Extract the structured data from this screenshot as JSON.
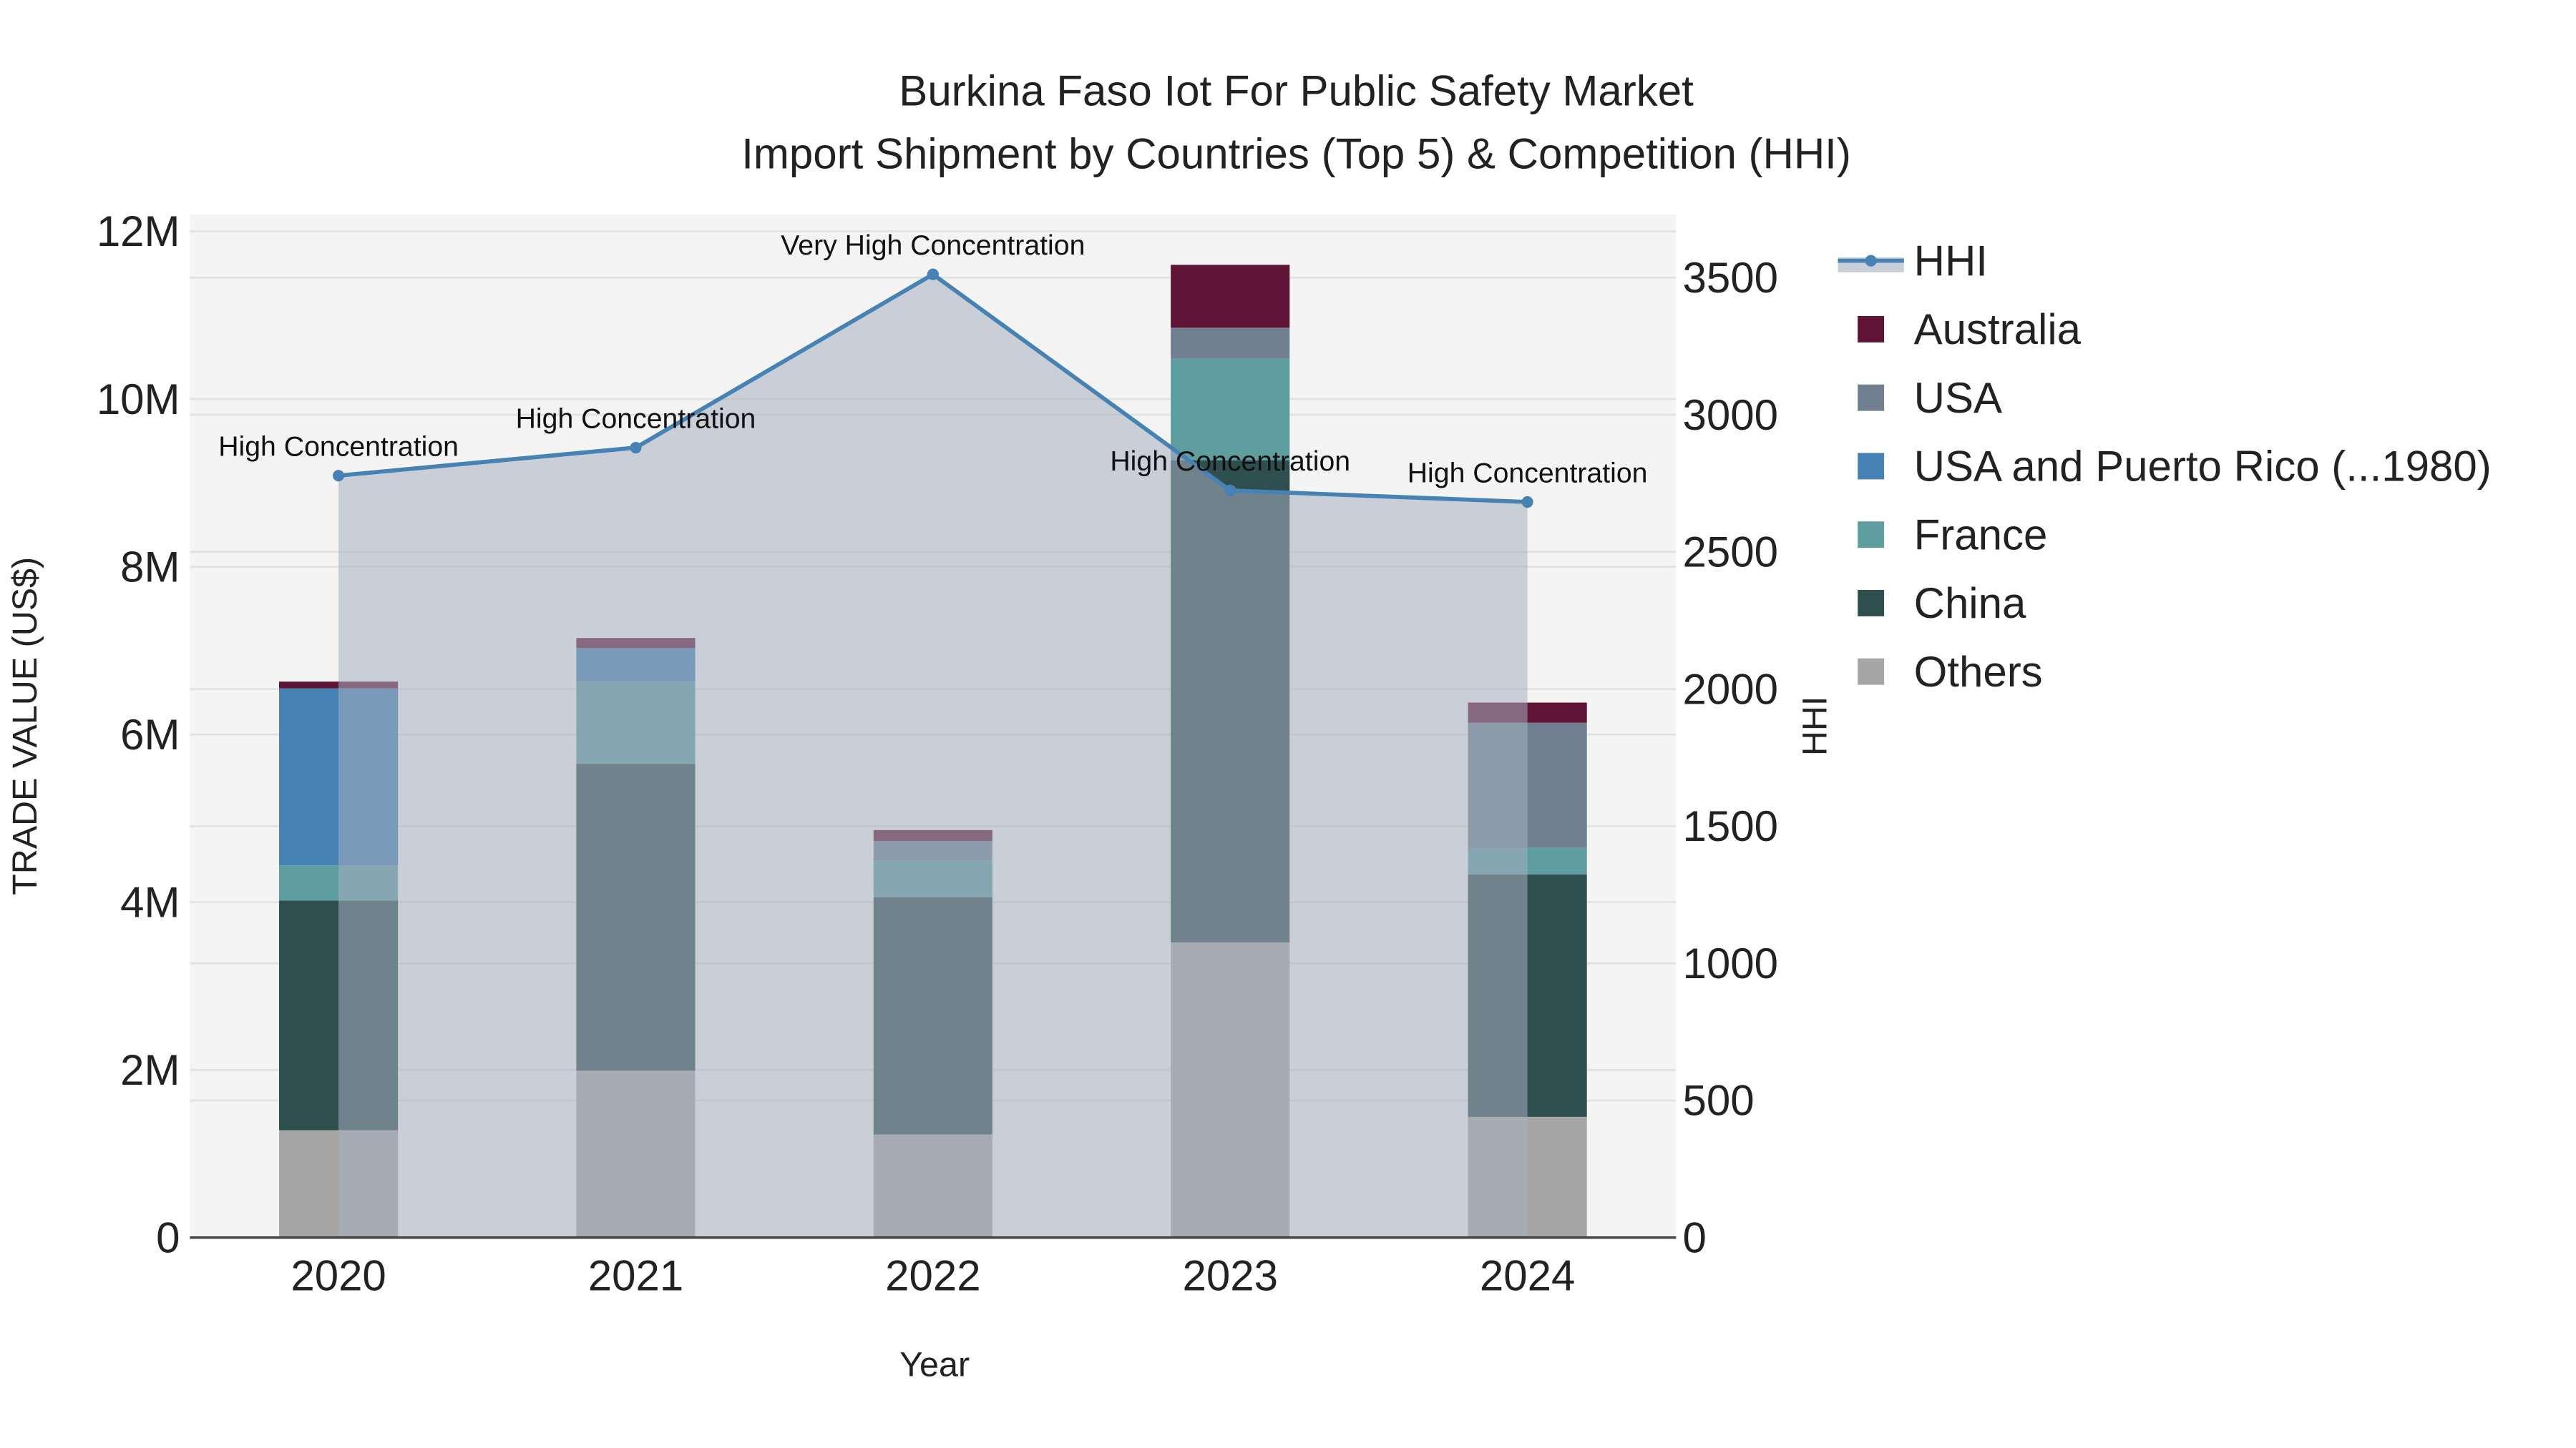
{
  "chart_data": {
    "type": "bar",
    "title": "Burkina Faso Iot For Public Safety Market",
    "subtitle": "Import Shipment by Countries (Top 5) & Competition (HHI)",
    "xlabel": "Year",
    "ylabel": "TRADE VALUE (US$)",
    "y2label": "HHI",
    "categories": [
      "2020",
      "2021",
      "2022",
      "2023",
      "2024"
    ],
    "ylim": [
      0,
      12200000
    ],
    "y2lim": [
      0,
      3730
    ],
    "yticks": [
      {
        "v": 0,
        "label": "0"
      },
      {
        "v": 2000000,
        "label": "2M"
      },
      {
        "v": 4000000,
        "label": "4M"
      },
      {
        "v": 6000000,
        "label": "6M"
      },
      {
        "v": 8000000,
        "label": "8M"
      },
      {
        "v": 10000000,
        "label": "10M"
      },
      {
        "v": 12000000,
        "label": "12M"
      }
    ],
    "y2ticks": [
      0,
      500,
      1000,
      1500,
      2000,
      2500,
      3000,
      3500
    ],
    "series": [
      {
        "name": "Others",
        "color": "#a6a6a6",
        "values": [
          1280000,
          1990000,
          1230000,
          3520000,
          1440000
        ]
      },
      {
        "name": "China",
        "color": "#2f4f4f",
        "values": [
          2740000,
          3660000,
          2830000,
          5750000,
          2890000
        ]
      },
      {
        "name": "France",
        "color": "#5f9ea0",
        "values": [
          420000,
          980000,
          440000,
          1210000,
          320000
        ]
      },
      {
        "name": "USA and Puerto Rico (...1980)",
        "color": "#4682b4",
        "values": [
          2110000,
          400000,
          0,
          0,
          0
        ]
      },
      {
        "name": "USA",
        "color": "#708090",
        "values": [
          0,
          0,
          230000,
          370000,
          1490000
        ]
      },
      {
        "name": "Australia",
        "color": "#5f1435",
        "values": [
          80000,
          120000,
          130000,
          750000,
          240000
        ]
      }
    ],
    "hhi": {
      "name": "HHI",
      "color": "#4682b4",
      "values": [
        2778,
        2880,
        3512,
        2724,
        2682
      ],
      "annotations": [
        "High Concentration",
        "High Concentration",
        "Very High Concentration",
        "High Concentration",
        "High Concentration"
      ]
    },
    "legend": [
      "HHI",
      "Australia",
      "USA",
      "USA and Puerto Rico (...1980)",
      "France",
      "China",
      "Others"
    ],
    "legend_position": "right",
    "grid": true
  }
}
